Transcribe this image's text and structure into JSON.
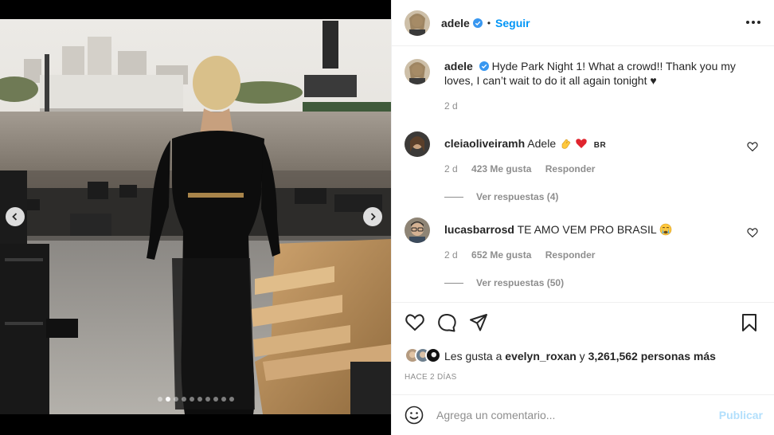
{
  "post": {
    "username": "adele",
    "follow_label": "Seguir",
    "separator": "•",
    "caption_text": "Hyde Park Night 1! What a crowd!! Thank you my loves, I can’t wait to do it all again tonight ♥",
    "caption_time": "2 d",
    "icons": {
      "verified": "verified-badge-icon",
      "more": "more-options-icon",
      "prev": "chevron-left-icon",
      "next": "chevron-right-icon"
    },
    "carousel": {
      "total": 10,
      "active_index": 1
    }
  },
  "comments": [
    {
      "username": "cleiaoliveiramh",
      "text": "Adele",
      "emojis": [
        "clapping-hands-emoji",
        "red-heart-emoji"
      ],
      "suffix": "BR",
      "time": "2 d",
      "likes": "423 Me gusta",
      "reply": "Responder",
      "view_replies": "Ver respuestas (4)"
    },
    {
      "username": "lucasbarrosd",
      "text": "TE AMO VEM PRO BRASIL",
      "emojis": [
        "crying-face-emoji"
      ],
      "time": "2 d",
      "likes": "652 Me gusta",
      "reply": "Responder",
      "view_replies": "Ver respuestas (50)"
    }
  ],
  "likes": {
    "prefix": "Les gusta a",
    "user": "evelyn_roxan",
    "joiner": "y",
    "count": "3,261,562 personas más"
  },
  "time_ago": "HACE 2 DÍAS",
  "add_comment": {
    "placeholder": "Agrega un comentario...",
    "publish_label": "Publicar"
  },
  "colors": {
    "accent": "#0095f6",
    "publish_disabled": "#b2dffc",
    "secondary_text": "#8e8e8e",
    "border": "#efefef"
  }
}
